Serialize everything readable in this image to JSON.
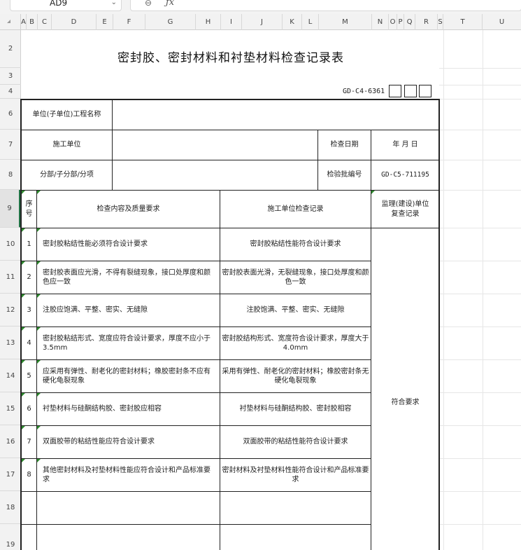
{
  "app": {
    "name_box": "AD9",
    "formula_icon": "fx-icon",
    "zoom_icon": "magnifier-icon"
  },
  "columns": [
    "A",
    "B",
    "C",
    "D",
    "E",
    "F",
    "G",
    "H",
    "I",
    "J",
    "K",
    "L",
    "M",
    "N",
    "O",
    "P",
    "Q",
    "R",
    "S",
    "T",
    "U"
  ],
  "rows": [
    "2",
    "3",
    "4",
    "6",
    "7",
    "8",
    "9",
    "10",
    "11",
    "12",
    "13",
    "14",
    "15",
    "16",
    "17",
    "18",
    "19"
  ],
  "sheet": {
    "title": "密封胶、密封材料和衬垫材料检查记录表",
    "form_code": "GD-C4-6361",
    "header": {
      "project_label": "单位(子单位)工程名称",
      "project_value": "",
      "contractor_label": "施工单位",
      "contractor_value": "",
      "check_date_label": "检查日期",
      "check_date_value": "年   月   日",
      "division_label": "分部/子分部/分项",
      "division_value": "",
      "batch_label": "检验批编号",
      "batch_value": "GD-C5-711195"
    },
    "table_head": {
      "seq": "序号",
      "requirement": "检查内容及质量要求",
      "record": "施工单位检查记录",
      "supervision": "监理(建设)单位复查记录"
    },
    "supervision_result": "符合要求",
    "items": [
      {
        "no": "1",
        "requirement": "密封胶粘结性能必须符合设计要求",
        "record": "密封胶粘结性能符合设计要求"
      },
      {
        "no": "2",
        "requirement": "密封胶表面应光滑，不得有裂缝现象，接口处厚度和颜色应一致",
        "record": "密封胶表面光滑，无裂缝现象，接口处厚度和颜色一致"
      },
      {
        "no": "3",
        "requirement": "注胶应饱满、平整、密实、无缝隙",
        "record": "注胶饱满、平整、密实、无缝隙"
      },
      {
        "no": "4",
        "requirement": "密封胶粘结形式、宽度应符合设计要求，厚度不应小于3.5mm",
        "record": "密封胶结构形式、宽度符合设计要求，厚度大于4.0mm"
      },
      {
        "no": "5",
        "requirement": "应采用有弹性、耐老化的密封材料；橡胶密封条不应有硬化龟裂现象",
        "record": "采用有弹性、耐老化的密封材料；橡胶密封条无硬化龟裂现象"
      },
      {
        "no": "6",
        "requirement": "衬垫材料与硅酮结构胶、密封胶应相容",
        "record": "衬垫材料与硅酮结构胶、密封胶相容"
      },
      {
        "no": "7",
        "requirement": "双面胶带的粘结性能应符合设计要求",
        "record": "双面胶带的粘结性能符合设计要求"
      },
      {
        "no": "8",
        "requirement": "其他密封材料及衬垫材料性能应符合设计和产品标准要求",
        "record": "密封材料及衬垫材料性能符合设计和产品标准要求"
      },
      {
        "no": "",
        "requirement": "",
        "record": ""
      },
      {
        "no": "",
        "requirement": "",
        "record": ""
      }
    ]
  }
}
